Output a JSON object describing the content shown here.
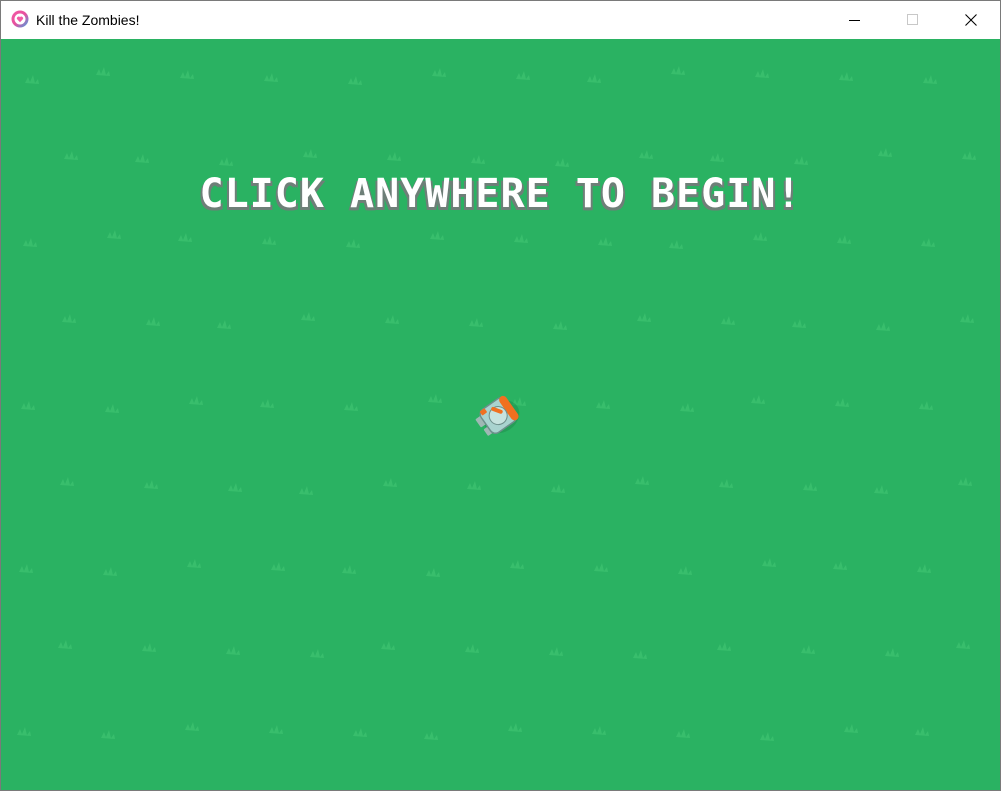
{
  "window": {
    "title": "Kill the Zombies!",
    "app_icon": "heart-circle-icon",
    "controls": {
      "minimize_icon": "minimize-icon",
      "maximize_icon": "maximize-icon",
      "close_icon": "close-icon"
    }
  },
  "game": {
    "prompt": "CLICK ANYWHERE TO BEGIN!",
    "background_color": "#2ab262",
    "grass_color": "#3bbf6f",
    "text_color": "#ffffff",
    "player_icon": "player-character-sprite"
  }
}
